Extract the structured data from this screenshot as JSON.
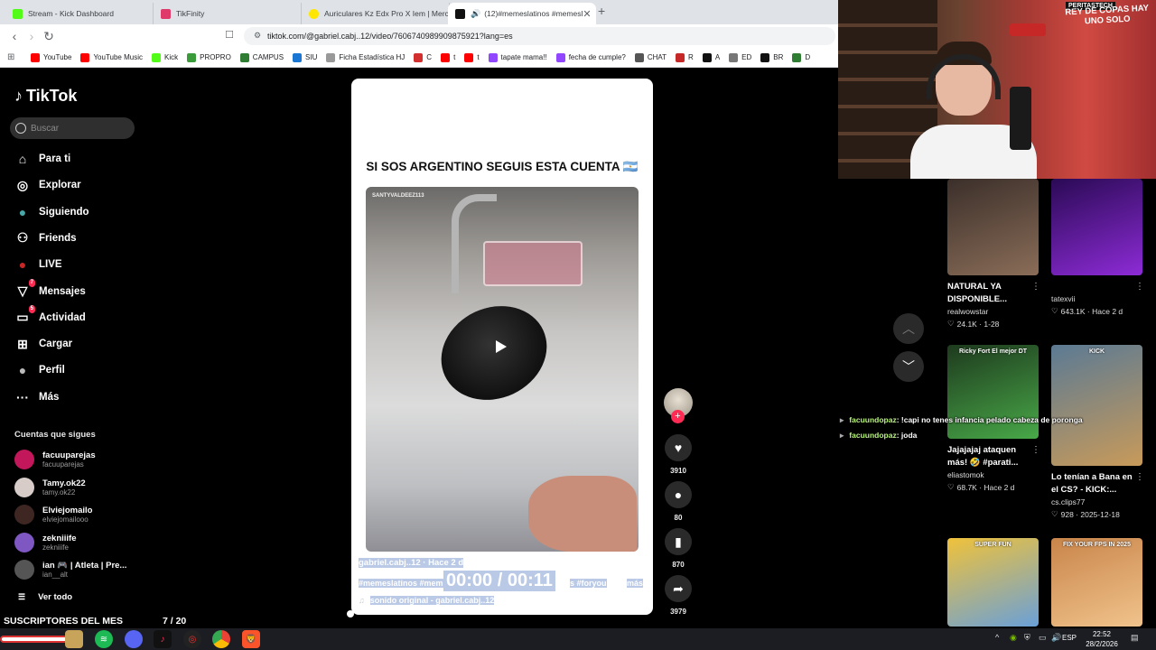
{
  "browser": {
    "tabs": [
      {
        "label": "Stream - Kick Dashboard",
        "color": "#53fc18",
        "glyph": "K"
      },
      {
        "label": "TikFinity",
        "color": "#e03a6b",
        "glyph": "T"
      },
      {
        "label": "Auriculares Kz Edx Pro X Iem | Mercad",
        "color": "#ffe600",
        "glyph": ""
      },
      {
        "label": "(12)#memeslatinos #memesl",
        "color": "#111111",
        "glyph": "♪"
      }
    ],
    "url": "tiktok.com/@gabriel.cabj..12/video/7606740989909875921?lang=es",
    "bookmarks": [
      {
        "label": "YouTube",
        "color": "#ff0000"
      },
      {
        "label": "YouTube Music",
        "color": "#ff0000"
      },
      {
        "label": "Kick",
        "color": "#53fc18"
      },
      {
        "label": "PROPRO",
        "color": "#3a9b3a"
      },
      {
        "label": "CAMPUS",
        "color": "#2e7d32"
      },
      {
        "label": "SIU",
        "color": "#1976d2"
      },
      {
        "label": "Ficha Estadística HJ",
        "color": "#999999"
      },
      {
        "label": "C",
        "color": "#d32f2f"
      },
      {
        "label": "t",
        "color": "#ff0000"
      },
      {
        "label": "t",
        "color": "#ff0000"
      },
      {
        "label": "tapate mama!!",
        "color": "#9146ff"
      },
      {
        "label": "fecha de cumple?",
        "color": "#9146ff"
      },
      {
        "label": "CHAT",
        "color": "#555555"
      },
      {
        "label": "R",
        "color": "#c62828"
      },
      {
        "label": "A",
        "color": "#111111"
      },
      {
        "label": "ED",
        "color": "#777777"
      },
      {
        "label": "BR",
        "color": "#111111"
      },
      {
        "label": "D",
        "color": "#2e7d32"
      }
    ]
  },
  "tiktok": {
    "logo": "TikTok",
    "search_placeholder": "Buscar",
    "nav": [
      {
        "label": "Para ti",
        "icon": "home-icon",
        "glyph": "⌂"
      },
      {
        "label": "Explorar",
        "icon": "compass-icon",
        "glyph": "◎"
      },
      {
        "label": "Siguiendo",
        "icon": "following-avatar-icon",
        "glyph": "●"
      },
      {
        "label": "Friends",
        "icon": "friends-icon",
        "glyph": "⚇"
      },
      {
        "label": "LIVE",
        "icon": "live-icon",
        "glyph": "●"
      },
      {
        "label": "Mensajes",
        "icon": "messages-icon",
        "glyph": "▽",
        "badge": "7"
      },
      {
        "label": "Actividad",
        "icon": "activity-icon",
        "glyph": "▭",
        "badge": "5"
      },
      {
        "label": "Cargar",
        "icon": "upload-icon",
        "glyph": "⊞"
      },
      {
        "label": "Perfil",
        "icon": "profile-icon",
        "glyph": "●"
      },
      {
        "label": "Más",
        "icon": "more-icon",
        "glyph": "···"
      }
    ],
    "following_title": "Cuentas que sigues",
    "following": [
      {
        "name": "facuuparejas",
        "handle": "facuuparejas",
        "color": "#c2185b"
      },
      {
        "name": "Tamy.ok22",
        "handle": "tamy.ok22",
        "color": "#d7ccc8"
      },
      {
        "name": "Elviejomailo",
        "handle": "elviejomailooo",
        "color": "#3e2723"
      },
      {
        "name": "zekniiife",
        "handle": "zekniiife",
        "color": "#7e57c2"
      },
      {
        "name": "ian 🎮 | Atleta | Pre...",
        "handle": "ian__alt",
        "color": "#555555"
      }
    ],
    "see_all": "Ver todo"
  },
  "video": {
    "title": "SI SOS ARGENTINO SEGUIS ESTA CUENTA 🇦🇷",
    "watermark": "SANTYVALDEEZ113",
    "author_line": "gabriel.cabj..12 · Hace 2 d",
    "tags_line": "#memeslatinos #mem",
    "tags_tail": "s #foryou",
    "more": "más",
    "sound": "sonido original - gabriel.cabj..12",
    "timecode": "00:00 / 00:11",
    "actions": [
      {
        "icon": "heart-icon",
        "glyph": "♥",
        "count": "3910"
      },
      {
        "icon": "comment-icon",
        "glyph": "●",
        "count": "80"
      },
      {
        "icon": "bookmark-icon",
        "glyph": "▮",
        "count": "870"
      },
      {
        "icon": "share-icon",
        "glyph": "➦",
        "count": "3979"
      }
    ]
  },
  "subscribers": {
    "label": "SUSCRIPTORES DEL MES",
    "count": "7 / 20"
  },
  "webcam": {
    "banner_top": "PERITASTECH",
    "banner": "REY DE COPAS HAY UNO SOLO"
  },
  "grid": [
    {
      "title": "NATURAL YA DISPONIBLE...",
      "user": "realwowstar",
      "stats": "24.1K · 1-28",
      "colors": [
        "#3b2f2a",
        "#8a6d58"
      ]
    },
    {
      "title": "",
      "user": "tatexvii",
      "stats": "643.1K · Hace 2 d",
      "colors": [
        "#2a0a55",
        "#8d2bd6"
      ]
    },
    {
      "title": "Jajajajaj ataquen más! 🤣 #parati...",
      "user": "eliastomok",
      "stats": "68.7K · Hace 2 d",
      "colors": [
        "#1e3a1e",
        "#48a848"
      ],
      "overlay": "Ricky Fort El mejor DT"
    },
    {
      "title": "Lo tenían a Bana en el CS? - KICK:...",
      "user": "cs.clips77",
      "stats": "928 · 2025-12-18",
      "colors": [
        "#5b7a94",
        "#c89a5a"
      ],
      "overlay": "KICK"
    },
    {
      "title": "",
      "user": "",
      "stats": "",
      "colors": [
        "#f0c23a",
        "#6aa0d8"
      ],
      "overlay": "SUPER FUN"
    },
    {
      "title": "",
      "user": "",
      "stats": "",
      "colors": [
        "#c9854a",
        "#f0c38c"
      ],
      "overlay": "FIX YOUR FPS IN 2025"
    }
  ],
  "chat": [
    {
      "user": "facuundopaz",
      "msg": ": !capi no tenes infancia pelado cabeza de poronga"
    },
    {
      "user": "facuundopaz",
      "msg": ": joda"
    }
  ],
  "taskbar": {
    "lang": "ESP",
    "time": "22:52",
    "date": "28/2/2026"
  }
}
